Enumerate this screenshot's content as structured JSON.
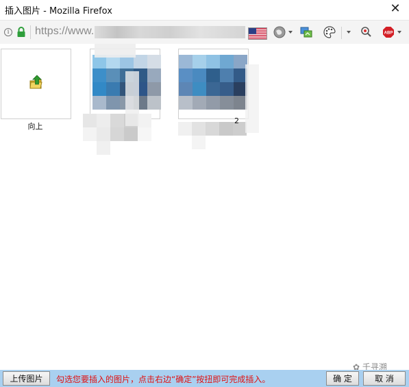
{
  "window": {
    "title": "插入图片 - Mozilla Firefox",
    "close_glyph": "✕"
  },
  "urlbar": {
    "url_prefix": "https://www.",
    "flag_icon": "us-flag-icon",
    "icons": [
      "info-icon",
      "lock-icon",
      "globe-icon",
      "image-translate-icon",
      "palette-icon",
      "search-zoom-icon",
      "adblock-plus-icon"
    ]
  },
  "content": {
    "up_tile_label": "向上",
    "up_icon": "folder-up-icon",
    "tile2_label": "2",
    "accent_folder": "#d8b533",
    "accent_arrow": "#2f9a2f"
  },
  "bottombar": {
    "upload_label": "上传图片",
    "hint": "勾选您要插入的图片，点击右边“确定”按扭即可完成插入。",
    "ok_label": "确 定",
    "cancel_label": "取 消",
    "bar_color": "#a9d0f0",
    "hint_color": "#e01010"
  },
  "watermark": {
    "text": "千寻溯"
  }
}
